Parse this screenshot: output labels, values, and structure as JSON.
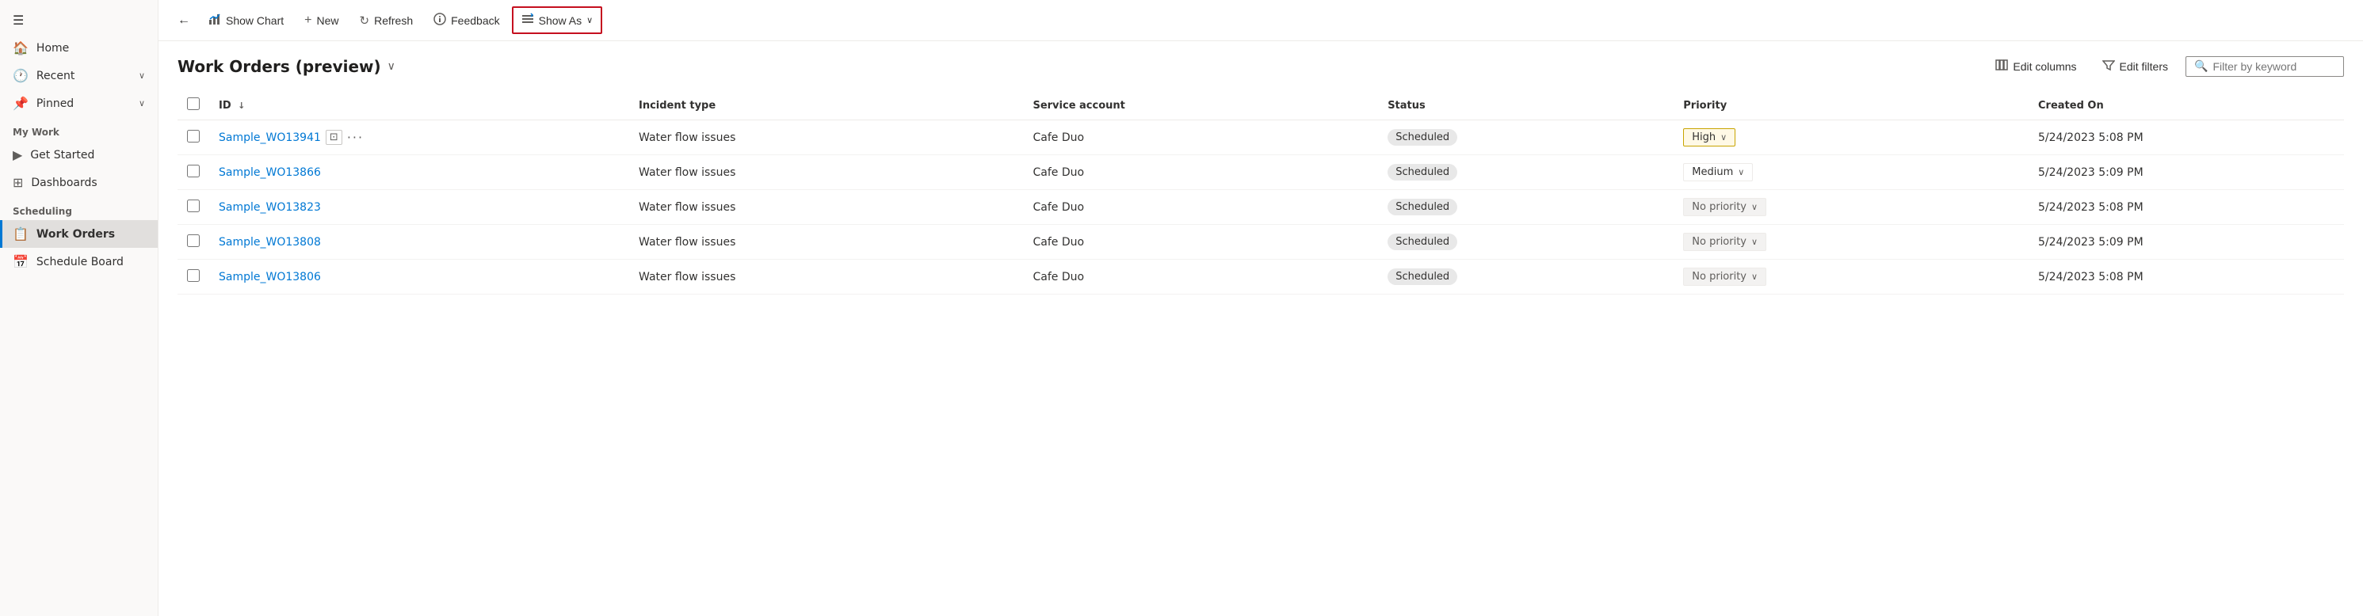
{
  "sidebar": {
    "nav_items": [
      {
        "id": "home",
        "label": "Home",
        "icon": "🏠",
        "has_chevron": false
      },
      {
        "id": "recent",
        "label": "Recent",
        "icon": "🕐",
        "has_chevron": true
      },
      {
        "id": "pinned",
        "label": "Pinned",
        "icon": "📌",
        "has_chevron": true
      }
    ],
    "my_work_label": "My Work",
    "my_work_items": [
      {
        "id": "get-started",
        "label": "Get Started",
        "icon": "▶"
      },
      {
        "id": "dashboards",
        "label": "Dashboards",
        "icon": "⊞"
      }
    ],
    "scheduling_label": "Scheduling",
    "scheduling_items": [
      {
        "id": "work-orders",
        "label": "Work Orders",
        "icon": "📋",
        "active": true
      },
      {
        "id": "schedule-board",
        "label": "Schedule Board",
        "icon": "📅"
      }
    ]
  },
  "toolbar": {
    "back_label": "←",
    "show_chart_label": "Show Chart",
    "new_label": "New",
    "refresh_label": "Refresh",
    "feedback_label": "Feedback",
    "show_as_label": "Show As"
  },
  "page": {
    "title": "Work Orders (preview)",
    "edit_columns_label": "Edit columns",
    "edit_filters_label": "Edit filters",
    "filter_placeholder": "Filter by keyword"
  },
  "table": {
    "columns": [
      {
        "id": "id",
        "label": "ID",
        "sortable": true
      },
      {
        "id": "incident_type",
        "label": "Incident type"
      },
      {
        "id": "service_account",
        "label": "Service account"
      },
      {
        "id": "status",
        "label": "Status"
      },
      {
        "id": "priority",
        "label": "Priority"
      },
      {
        "id": "created_on",
        "label": "Created On"
      }
    ],
    "rows": [
      {
        "id": "Sample_WO13941",
        "incident_type": "Water flow issues",
        "service_account": "Cafe Duo",
        "status": "Scheduled",
        "priority": "High",
        "priority_class": "high",
        "created_on": "5/24/2023 5:08 PM"
      },
      {
        "id": "Sample_WO13866",
        "incident_type": "Water flow issues",
        "service_account": "Cafe Duo",
        "status": "Scheduled",
        "priority": "Medium",
        "priority_class": "medium",
        "created_on": "5/24/2023 5:09 PM"
      },
      {
        "id": "Sample_WO13823",
        "incident_type": "Water flow issues",
        "service_account": "Cafe Duo",
        "status": "Scheduled",
        "priority": "No priority",
        "priority_class": "no-priority",
        "created_on": "5/24/2023 5:08 PM"
      },
      {
        "id": "Sample_WO13808",
        "incident_type": "Water flow issues",
        "service_account": "Cafe Duo",
        "status": "Scheduled",
        "priority": "No priority",
        "priority_class": "no-priority",
        "created_on": "5/24/2023 5:09 PM"
      },
      {
        "id": "Sample_WO13806",
        "incident_type": "Water flow issues",
        "service_account": "Cafe Duo",
        "status": "Scheduled",
        "priority": "No priority",
        "priority_class": "no-priority",
        "created_on": "5/24/2023 5:08 PM"
      }
    ]
  }
}
